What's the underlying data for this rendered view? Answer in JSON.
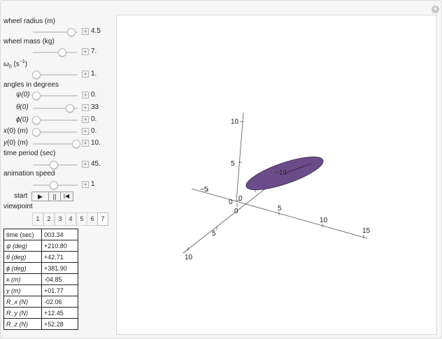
{
  "controls": {
    "wheel_radius_label": "wheel radius (m)",
    "wheel_radius_value": "4.5",
    "wheel_mass_label": "wheel mass (kg)",
    "wheel_mass_value": "7.",
    "omega_label_pre": "ω",
    "omega_sub": "0",
    "omega_unit_pre": " (s",
    "omega_unit_sup": "−1",
    "omega_unit_post": ")",
    "omega_value": "1.",
    "angles_heading": "angles in degrees",
    "psi_label": "ψ(0)",
    "psi_value": "0.",
    "theta_label": "θ(0)",
    "theta_value": "33",
    "phi_label": "ϕ(0)",
    "phi_value": "0.",
    "x0_label_i": "x",
    "x0_label_rest": "(0) (m)",
    "x0_value": "0.",
    "y0_label_i": "y",
    "y0_label_rest": "(0) (m)",
    "y0_value": "10.",
    "time_period_label": "time period (sec)",
    "time_period_value": "45.",
    "anim_speed_label": "animation speed",
    "anim_speed_value": "1",
    "start_label": "start",
    "play_icon": "▶",
    "pause_icon": "||",
    "reset_icon": "|◀",
    "viewpoint_label": "viewpoint",
    "viewpoints": [
      "1",
      "2",
      "3",
      "4",
      "5",
      "6",
      "7"
    ],
    "selected_viewpoint": "7"
  },
  "readout": [
    {
      "k": "time (sec)",
      "v": "003.34"
    },
    {
      "k": "ψ (deg)",
      "v": "+210.80"
    },
    {
      "k": "θ (deg)",
      "v": "+42.71"
    },
    {
      "k": "ϕ (deg)",
      "v": "+381.90"
    },
    {
      "k": "x (m)",
      "v": "-04.85"
    },
    {
      "k": "y (m)",
      "v": "+01.77"
    },
    {
      "k": "R_x (N)",
      "v": "-02.06"
    },
    {
      "k": "R_y (N)",
      "v": "+12.45"
    },
    {
      "k": "R_z (N)",
      "v": "+52.28"
    }
  ],
  "plot": {
    "z_ticks": [
      "10",
      "5",
      "0"
    ],
    "x_ticks": [
      "0",
      "5",
      "10",
      "15"
    ],
    "y_ticks": [
      "−5",
      "0",
      "5",
      "10"
    ],
    "disk_label": "−10",
    "disk_color": "#6b4c8a"
  }
}
